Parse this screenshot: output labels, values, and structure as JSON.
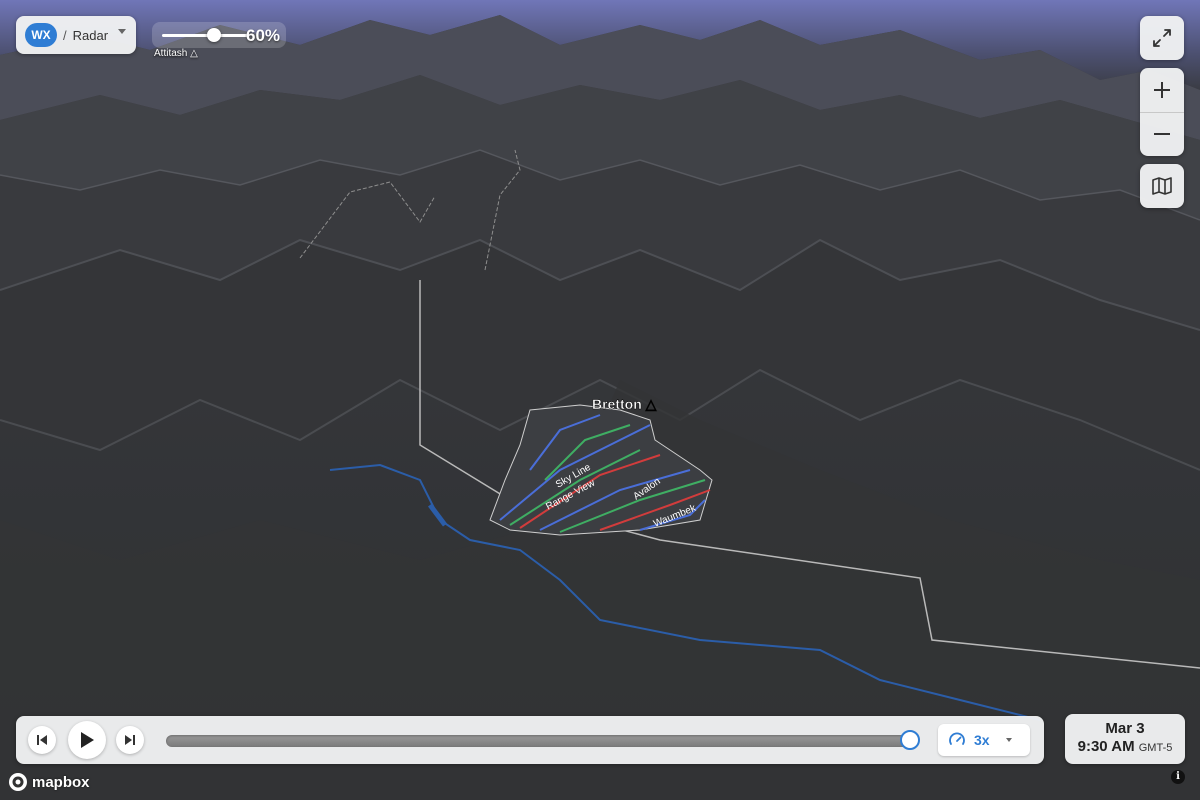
{
  "layer": {
    "badge": "WX",
    "separator": "/",
    "name": "Radar"
  },
  "opacity": {
    "value_text": "60%",
    "value": 0.6,
    "peak_label": "Attitash △"
  },
  "map": {
    "peak_label": "Bretton △",
    "trail_labels": [
      "Range View",
      "Avalon",
      "Waumbek",
      "Sky Line"
    ],
    "provider": "mapbox"
  },
  "controls": {
    "fullscreen_icon": "expand-icon",
    "zoom_in_icon": "plus-icon",
    "zoom_out_icon": "minus-icon",
    "basemap_icon": "map-icon"
  },
  "playback": {
    "progress": 0.99,
    "speed": "3x",
    "speed_icon": "gauge-icon",
    "prev_icon": "skip-back-icon",
    "play_icon": "play-icon",
    "next_icon": "skip-forward-icon"
  },
  "datetime": {
    "date": "Mar 3",
    "time": "9:30 AM",
    "tz": "GMT-5"
  },
  "colors": {
    "accent": "#2f7dd4",
    "trail_blue": "#4a6ed8",
    "trail_green": "#3fae63",
    "trail_red": "#d23c3c",
    "boundary": "#b9b9b9",
    "river": "#2b5da8"
  }
}
